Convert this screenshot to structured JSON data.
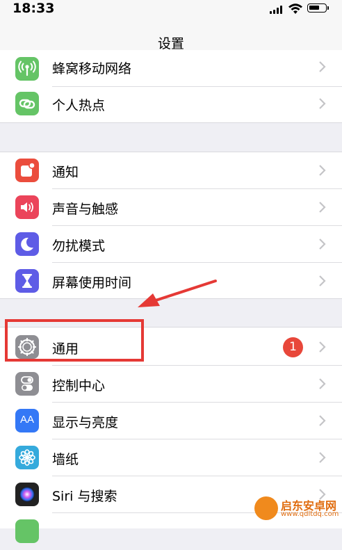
{
  "status_bar": {
    "time": "18:33"
  },
  "nav": {
    "title": "设置"
  },
  "groups": [
    {
      "items": [
        {
          "label": "蜂窝移动网络",
          "icon": "cellular-icon",
          "color": "#65c466"
        },
        {
          "label": "个人热点",
          "icon": "hotspot-icon",
          "color": "#65c466"
        }
      ]
    },
    {
      "items": [
        {
          "label": "通知",
          "icon": "notifications-icon",
          "color": "#eb4d3d"
        },
        {
          "label": "声音与触感",
          "icon": "sound-icon",
          "color": "#eb445a"
        },
        {
          "label": "勿扰模式",
          "icon": "moon-icon",
          "color": "#5e5ce6"
        },
        {
          "label": "屏幕使用时间",
          "icon": "hourglass-icon",
          "color": "#5e5ce6"
        }
      ]
    },
    {
      "items": [
        {
          "label": "通用",
          "icon": "gear-icon",
          "color": "#8e8e93",
          "badge": "1"
        },
        {
          "label": "控制中心",
          "icon": "toggle-icon",
          "color": "#8e8e93"
        },
        {
          "label": "显示与亮度",
          "icon": "aa-icon",
          "color": "#3478f6"
        },
        {
          "label": "墙纸",
          "icon": "flower-icon",
          "color": "#35aadc"
        },
        {
          "label": "Siri 与搜索",
          "icon": "siri-icon",
          "color": "#222222"
        }
      ]
    }
  ],
  "display_icon_text": "AA",
  "watermark": {
    "title": "启东安卓网",
    "url": "www.qdltdq.com"
  }
}
